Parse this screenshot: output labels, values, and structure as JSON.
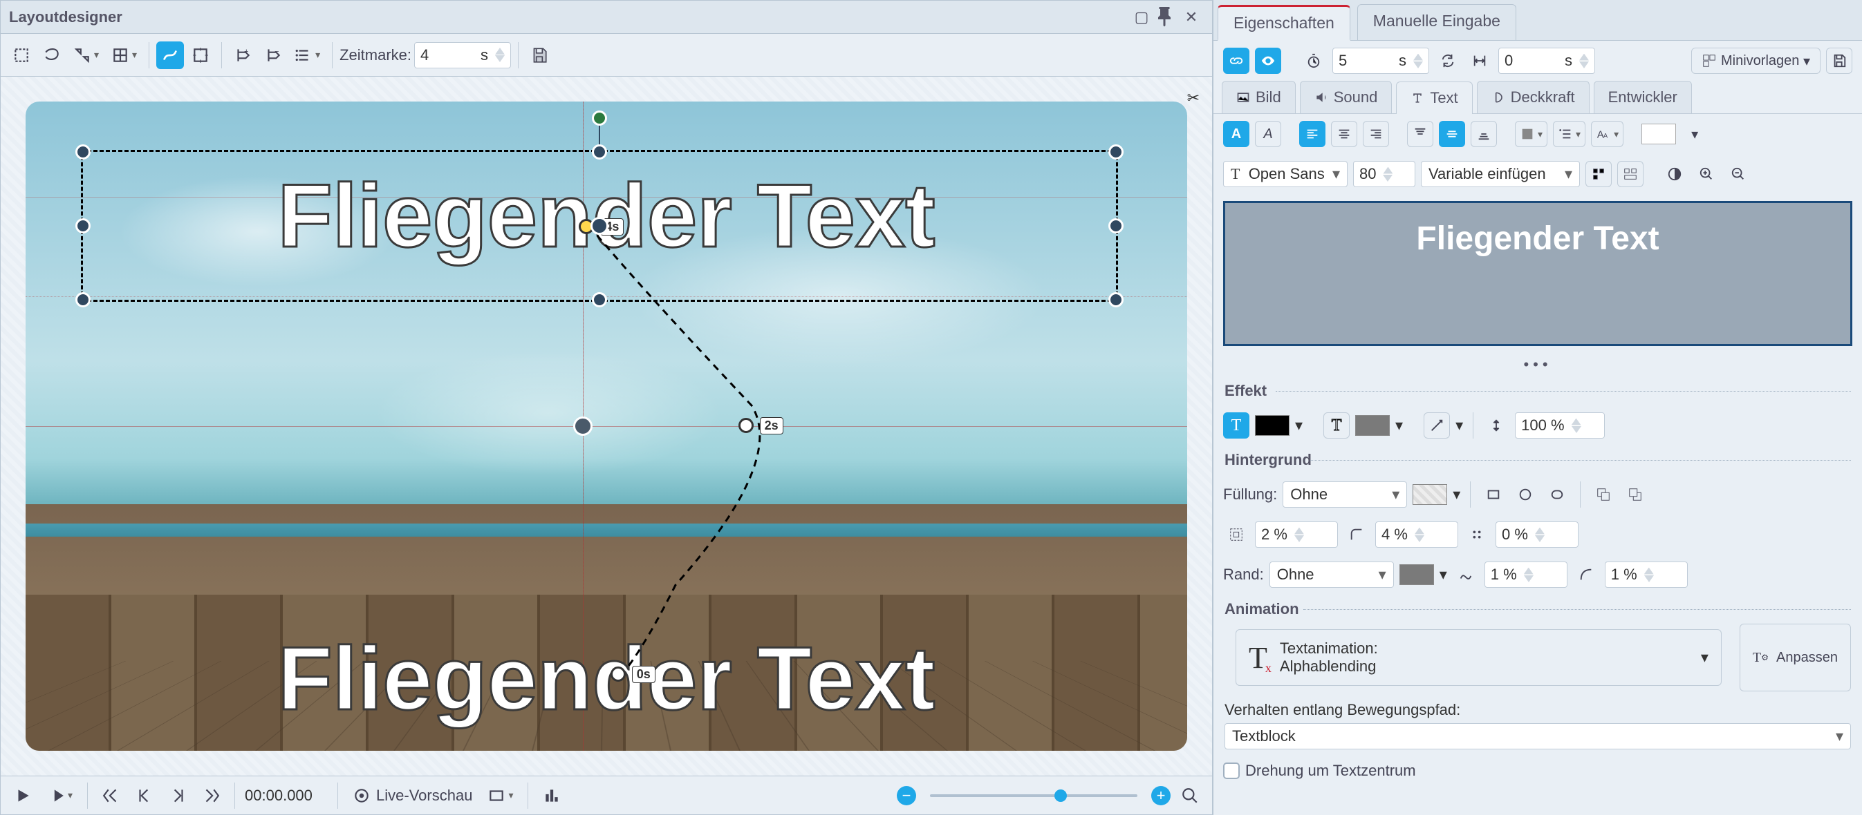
{
  "window": {
    "title": "Layoutdesigner"
  },
  "toolbar": {
    "timemark_label": "Zeitmarke:",
    "timemark_value": "4",
    "timemark_unit": "s"
  },
  "canvas": {
    "main_text": "Fliegender Text",
    "kf_labels": {
      "k0": "0s",
      "k2": "2s",
      "k4": "4s"
    }
  },
  "footer": {
    "time_display": "00:00.000",
    "live_preview": "Live-Vorschau"
  },
  "right_tabs": {
    "props": "Eigenschaften",
    "manual": "Manuelle Eingabe"
  },
  "props_bar": {
    "duration": "5",
    "duration_unit": "s",
    "offset": "0",
    "offset_unit": "s",
    "templates": "Minivorlagen"
  },
  "subtabs": {
    "bild": "Bild",
    "sound": "Sound",
    "text": "Text",
    "opacity": "Deckkraft",
    "dev": "Entwickler"
  },
  "text_panel": {
    "font": "Open Sans",
    "size": "80",
    "variable": "Variable einfügen",
    "preview": "Fliegender Text"
  },
  "effect": {
    "header": "Effekt",
    "opacity_value": "100 %"
  },
  "background": {
    "header": "Hintergrund",
    "fill_label": "Füllung:",
    "fill_value": "Ohne",
    "v1": "2 %",
    "v2": "4 %",
    "v3": "0 %",
    "border_label": "Rand:",
    "border_value": "Ohne",
    "b1": "1 %",
    "b2": "1 %"
  },
  "animation": {
    "header": "Animation",
    "name_label": "Textanimation:",
    "name_value": "Alphablending",
    "adjust": "Anpassen",
    "behavior_label": "Verhalten entlang Bewegungspfad:",
    "behavior_value": "Textblock",
    "rotation_label": "Drehung um Textzentrum"
  }
}
